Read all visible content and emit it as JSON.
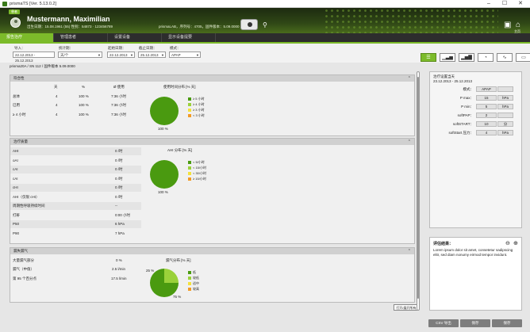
{
  "window": {
    "title": "prismaTS [Ver. 5.13.0.2]",
    "minimize": "–",
    "maximize": "☐",
    "close": "✕"
  },
  "header": {
    "patient_badge": "患者",
    "patient_name": "Mustermann, Maximilian",
    "patient_info": "出生日期：15.08.1961 (55) 性别：54873 · 123456789",
    "device_info": "prismaLAB，序列号：4705，固件版本：5.09.0000",
    "settings_label": "",
    "home_label": "主页"
  },
  "tabs": [
    "报告治疗",
    "管理患者",
    "设置设备",
    "显示设备提要"
  ],
  "filters": {
    "import_label": "导入：",
    "import_value": "22.12.2013 - 25.12.2013",
    "interval_label": "统计期：",
    "interval_value": "天/个",
    "start_label": "起始日期：",
    "start_value": "22.12.2013",
    "end_label": "截止日期：",
    "end_value": "25.12.2013",
    "mode_label": "模式：",
    "mode_value": "APAP"
  },
  "device_line": "prisma20A / SN 112 / 固件版本 5.09.0000",
  "compliance": {
    "title": "符合性",
    "col_days": "天",
    "col_pct": "%",
    "col_avg": "Ø 使用",
    "rows": [
      {
        "label": "总体",
        "days": "4",
        "pct": "100 %",
        "avg": "7:36 小时"
      },
      {
        "label": "已用",
        "days": "4",
        "pct": "100 %",
        "avg": "7:36 小时"
      },
      {
        "label": "≥ 4 小时",
        "days": "4",
        "pct": "100 %",
        "avg": "7:36 小时"
      }
    ],
    "chart_title": "使用时间分布 [% 天]",
    "pie_label": "100 %",
    "legend": [
      "≥ 5 小时",
      "≥ 4 小时",
      "≥ 3 小时",
      "< 3 小时"
    ]
  },
  "therapy": {
    "title": "治疗质量",
    "rows": [
      {
        "label": "AHI",
        "value": "0 /时"
      },
      {
        "label": "oAI",
        "value": "0 /时"
      },
      {
        "label": "cAI",
        "value": "0 /时"
      },
      {
        "label": "cAI",
        "value": "0 /时"
      },
      {
        "label": "cHI",
        "value": "0 /时"
      },
      {
        "label": "AHI（仅限 cHI）",
        "value": "0 /时"
      },
      {
        "label": "周期性呼吸持续时间",
        "value": "--"
      },
      {
        "label": "打鼾",
        "value": "0:00 小时"
      },
      {
        "label": "P50",
        "value": "6 hPa"
      },
      {
        "label": "P90",
        "value": "7 hPa"
      }
    ],
    "chart_title": "AHI 分布 [% 天]",
    "pie_label": "100 %",
    "legend": [
      "< 5/小时",
      "< 15/小时",
      "< 30/小时",
      "≥ 15/小时"
    ]
  },
  "leak": {
    "title": "漏失漏气",
    "rows": [
      {
        "label": "大量漏气部分",
        "value": "0 %"
      },
      {
        "label": "漏气（中值）",
        "value": "2.5 l/min"
      },
      {
        "label": "第 95 个百分点",
        "value": "17.5 l/min"
      }
    ],
    "chart_title": "漏气分布 [% 天]",
    "pie_small": "25 %",
    "pie_large": "75 %",
    "legend": [
      "低",
      "较低",
      "适中",
      "较高"
    ]
  },
  "right_panel": {
    "title": "治疗设置当天",
    "date_range": "23.12.2013 - 25.12.2013",
    "rows": [
      {
        "label": "模式：",
        "value": "APAP",
        "unit": ""
      },
      {
        "label": "P max：",
        "value": "15",
        "unit": "hPa"
      },
      {
        "label": "P min：",
        "value": "5",
        "unit": "hPa"
      },
      {
        "label": "softPAP：",
        "value": "2",
        "unit": ""
      },
      {
        "label": "softSTART：",
        "value": "10",
        "unit": "分"
      },
      {
        "label": "softStart 压力：",
        "value": "4",
        "unit": "hPa"
      }
    ]
  },
  "comment": {
    "title": "评估结果：",
    "text": "Lorem ipsum dolor sit amet, consetetur sadipscing elitr, sed diam nonumy eirmod tempor invidunt."
  },
  "expand_all": "打开/展开所有",
  "buttons": {
    "csv": "CSV 导出",
    "save": "保存",
    "print": "保存"
  },
  "colors": {
    "accent": "#7cbb2a",
    "green_dark": "#4a9a10",
    "green_light": "#9ad13a",
    "yellow": "#f3e23a",
    "orange": "#f39b24"
  }
}
